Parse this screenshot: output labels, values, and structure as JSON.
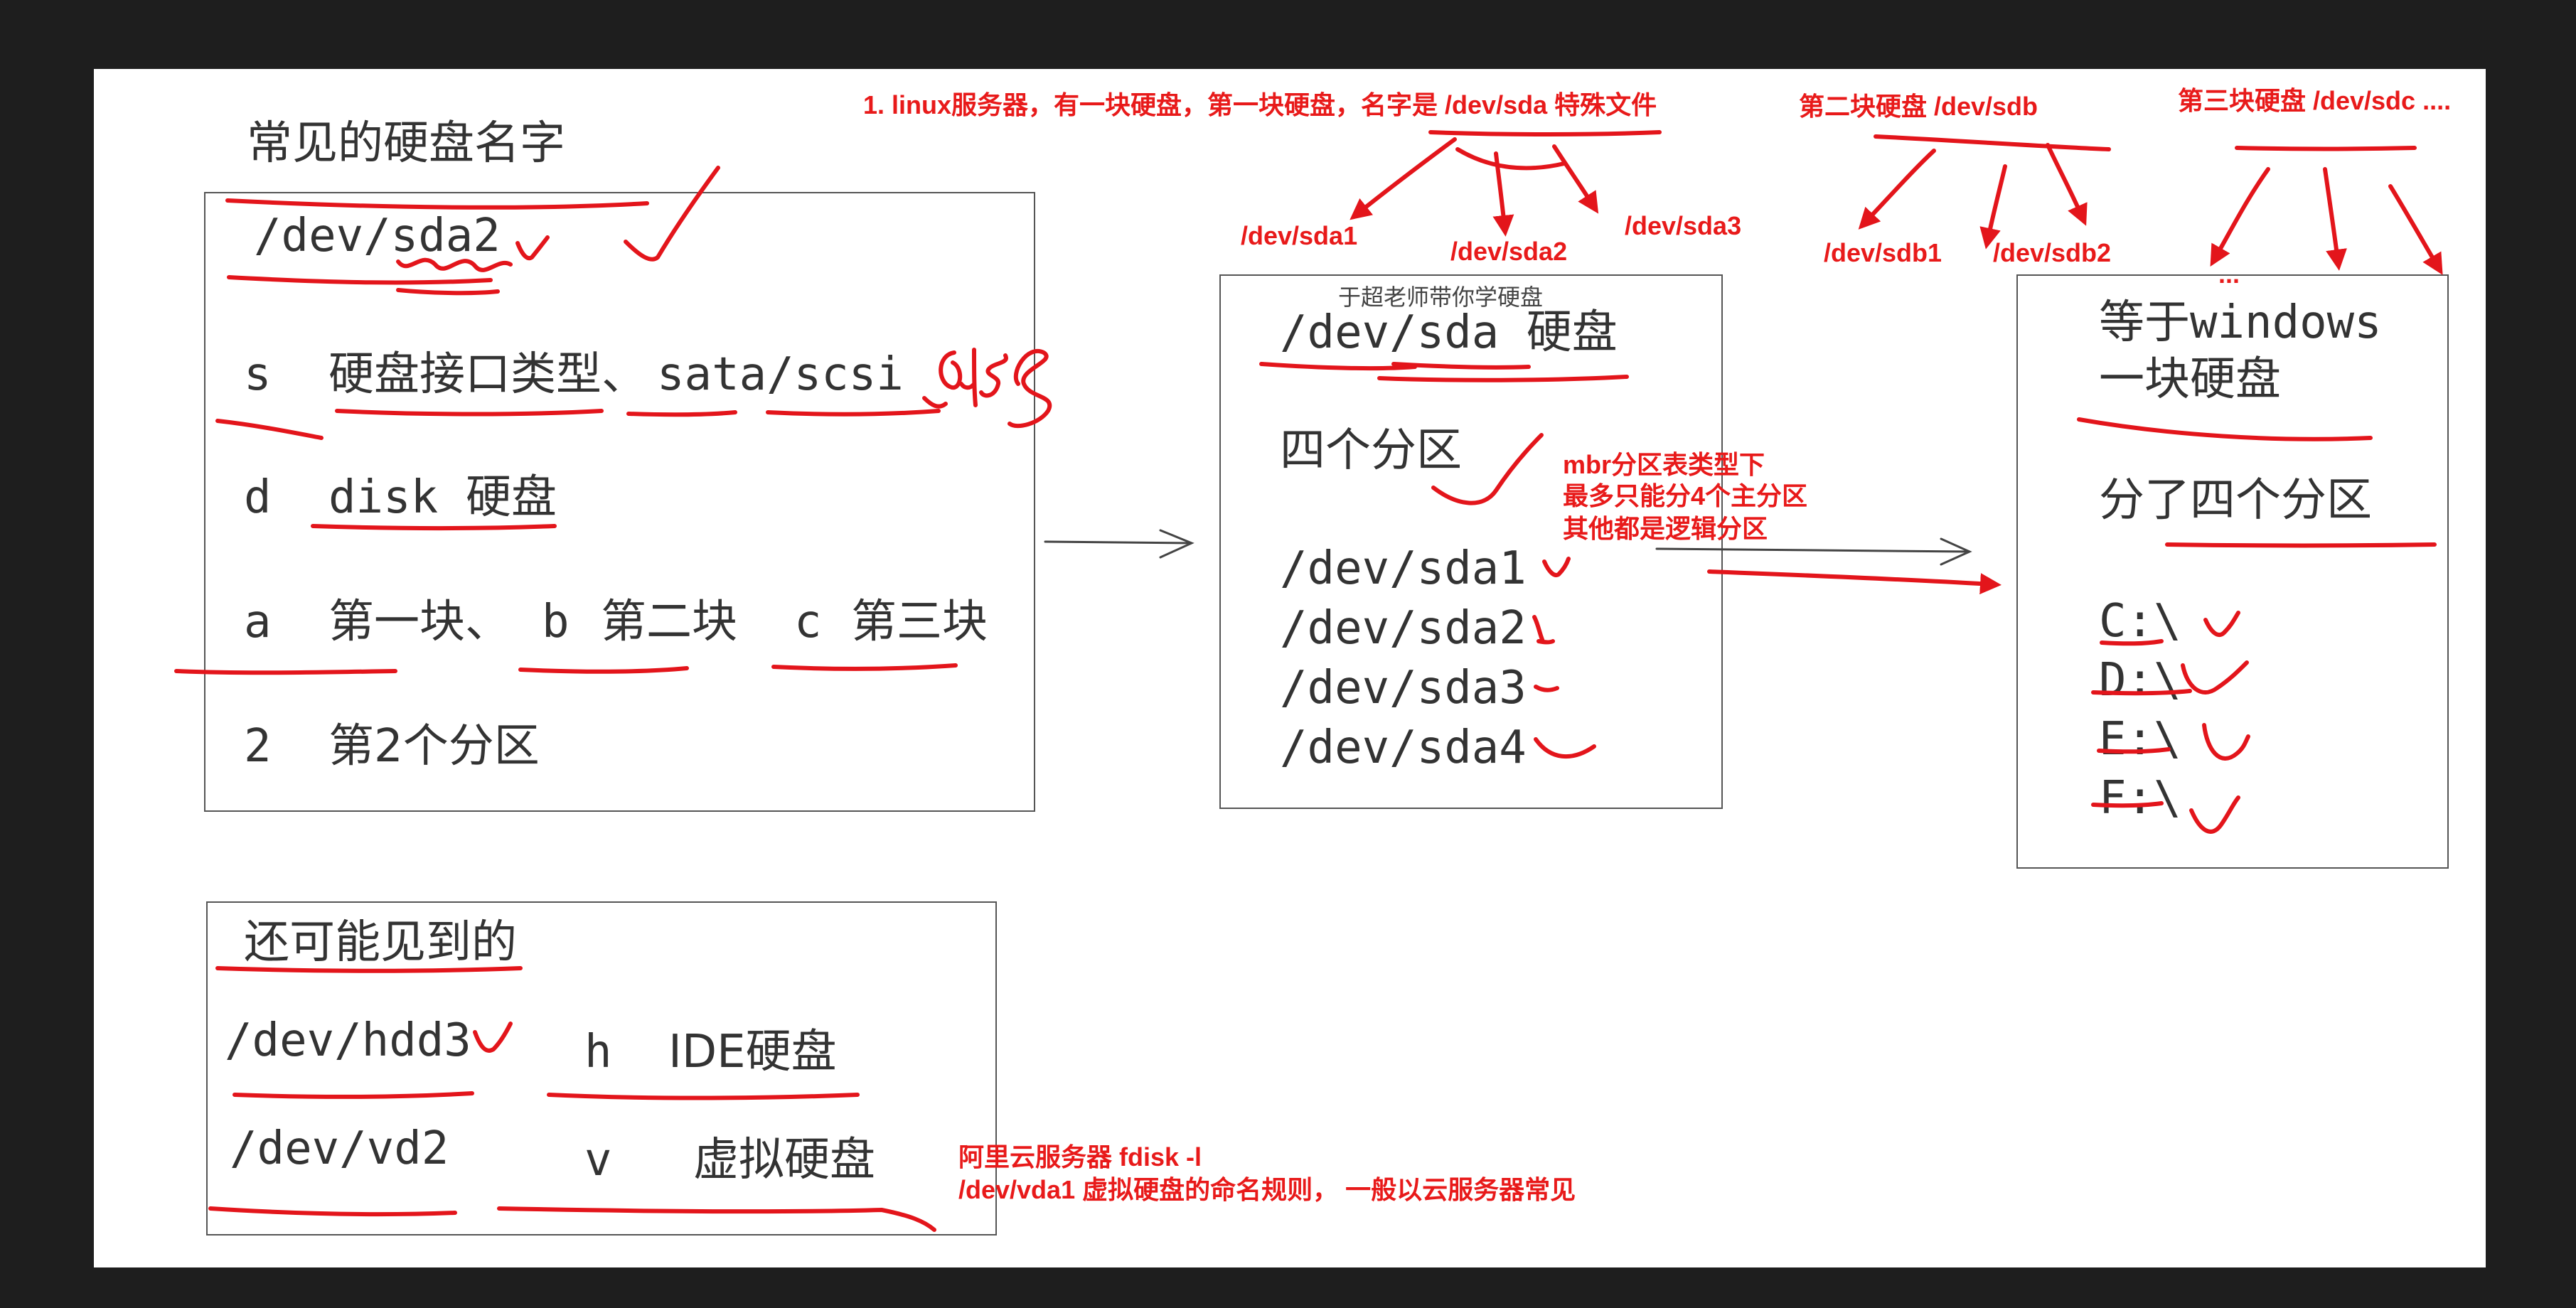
{
  "colors": {
    "background": "#1e1e1e",
    "canvas": "#ffffff",
    "ink_red": "#e3151b",
    "text": "#333333"
  },
  "panel1": {
    "heading": "常见的硬盘名字",
    "device": "/dev/sda2",
    "rows": [
      {
        "key": "s",
        "desc": "硬盘接口类型、",
        "extra": "sata/scsi",
        "handwritten": "sas"
      },
      {
        "key": "d",
        "desc": "disk",
        "extra": "硬盘"
      },
      {
        "key": "a",
        "desc": "第一块、",
        "b_key": "b",
        "b_desc": "第二块",
        "c_key": "c",
        "c_desc": "第三块"
      },
      {
        "key": "2",
        "desc": "第2个分区"
      }
    ]
  },
  "panel2": {
    "caption": "于超老师带你学硬盘",
    "device": "/dev/sda 硬盘",
    "partitions_title": "四个分区",
    "partitions": [
      "/dev/sda1",
      "/dev/sda2",
      "/dev/sda3",
      "/dev/sda4"
    ]
  },
  "panel3": {
    "line1": "等于windows",
    "line2": "一块硬盘",
    "line3": "分了四个分区",
    "drives": [
      "C:\\",
      "D:\\",
      "E:\\",
      "F:\\"
    ]
  },
  "panel4": {
    "heading": "还可能见到的",
    "row1_dev": "/dev/hdd3",
    "row1_key": "h",
    "row1_desc": "IDE硬盘",
    "row2_dev": "/dev/vd2",
    "row2_key": "v",
    "row2_desc": "虚拟硬盘"
  },
  "annotations": {
    "linux_first_disk": "1. linux服务器，有一块硬盘，第一块硬盘，名字是 /dev/sda 特殊文件",
    "sda1": "/dev/sda1",
    "sda2": "/dev/sda2",
    "sda3": "/dev/sda3",
    "second_disk": "第二块硬盘 /dev/sdb",
    "sdb1": "/dev/sdb1",
    "sdb2": "/dev/sdb2",
    "third_disk": "第三块硬盘 /dev/sdc ....",
    "ellipsis": "...",
    "mbr1": "mbr分区表类型下",
    "mbr2": "最多只能分4个主分区",
    "mbr3": "其他都是逻辑分区",
    "aliyun1": "阿里云服务器    fdisk -l",
    "aliyun2": "/dev/vda1 虚拟硬盘的命名规则，  一般以云服务器常见"
  }
}
